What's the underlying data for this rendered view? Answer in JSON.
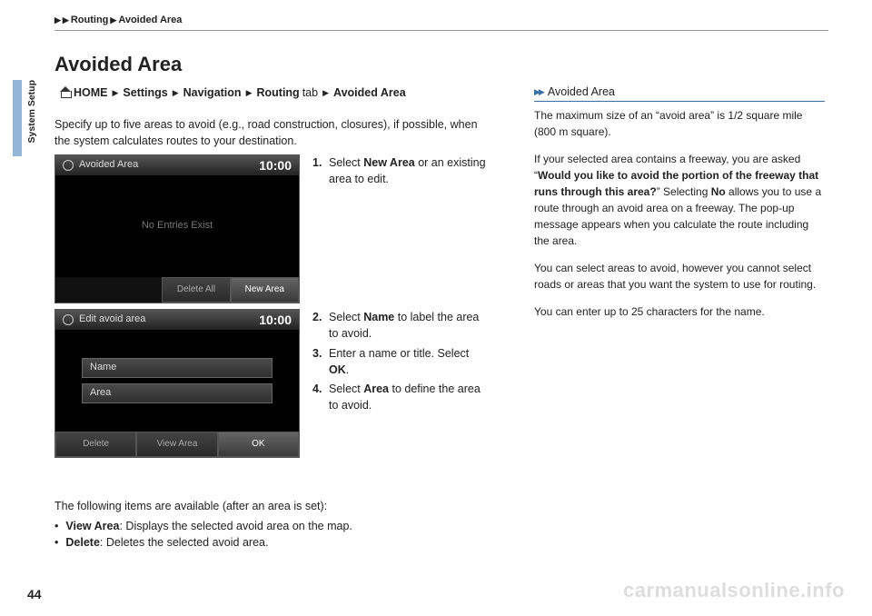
{
  "header": {
    "crumb1": "Routing",
    "crumb2": "Avoided Area"
  },
  "sidebar_tab": "System Setup",
  "title": "Avoided Area",
  "path": {
    "home": "HOME",
    "p1": "Settings",
    "p2": "Navigation",
    "p3": "Routing",
    "tabword": "tab",
    "p4": "Avoided Area"
  },
  "intro": "Specify up to five areas to avoid (e.g., road construction, closures), if possible, when the system calculates routes to your destination.",
  "shot1": {
    "title": "Avoided Area",
    "clock": "10:00",
    "msg": "No Entries Exist",
    "btn1": "Delete All",
    "btn2": "New Area"
  },
  "step1": {
    "num": "1.",
    "pre": "Select ",
    "bold": "New Area",
    "post": " or an existing area to edit."
  },
  "shot2": {
    "title": "Edit avoid area",
    "clock": "10:00",
    "f1": "Name",
    "f2": "Area",
    "btn1": "Delete",
    "btn2": "View Area",
    "btn3": "OK"
  },
  "step2": {
    "num": "2.",
    "pre": "Select ",
    "bold": "Name",
    "post": " to label the area to avoid."
  },
  "step3": {
    "num": "3.",
    "pre": "Enter a name or title. Select ",
    "bold": "OK",
    "post": "."
  },
  "step4": {
    "num": "4.",
    "pre": "Select ",
    "bold": "Area",
    "post": " to define the area to avoid."
  },
  "after": {
    "lead": "The following items are available (after an area is set):",
    "i1b": "View Area",
    "i1t": ": Displays the selected avoid area on the map.",
    "i2b": "Delete",
    "i2t": ": Deletes the selected avoid area."
  },
  "side": {
    "hdr": "Avoided Area",
    "p1": "The maximum size of an “avoid area” is 1/2 square mile (800 m square).",
    "p2a": "If your selected area contains a freeway, you are asked “",
    "p2b": "Would you like to avoid the portion of the freeway that runs through this area?",
    "p2c": "” Selecting ",
    "p2d": "No",
    "p2e": " allows you to use a route through an avoid area on a freeway. The pop-up message appears when you calculate the route including the area.",
    "p3": "You can select areas to avoid, however you cannot select roads or areas that you want the system to use for routing.",
    "p4": "You can enter up to 25 characters for the name."
  },
  "pagenum": "44",
  "watermark": "carmanualsonline.info"
}
